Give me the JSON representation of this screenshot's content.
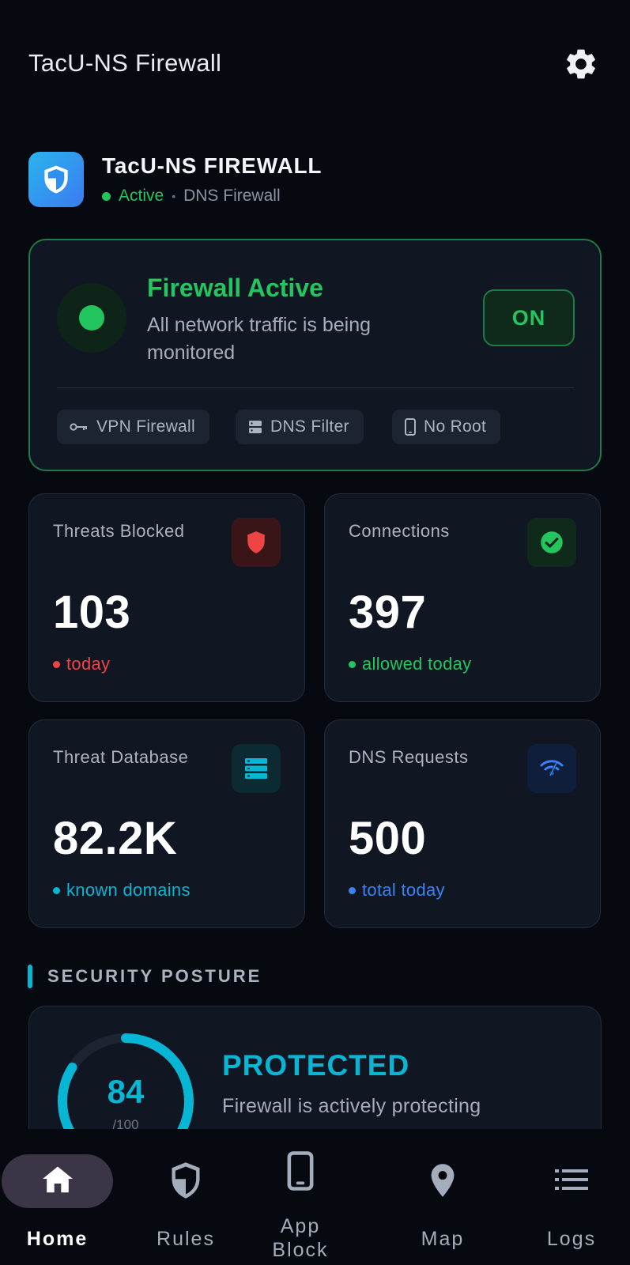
{
  "app_bar": {
    "title": "TacU-NS Firewall",
    "settings_icon": "gear-icon"
  },
  "brand": {
    "name": "TacU-NS FIREWALL",
    "status": "Active",
    "separator": "•",
    "mode": "DNS Firewall",
    "logo_icon": "shield-icon"
  },
  "firewall": {
    "title": "Firewall Active",
    "description": "All network traffic is being monitored",
    "toggle_label": "ON",
    "chips": [
      {
        "label": "VPN Firewall",
        "icon": "key-icon"
      },
      {
        "label": "DNS Filter",
        "icon": "server-icon"
      },
      {
        "label": "No Root",
        "icon": "phone-icon"
      }
    ]
  },
  "stats": {
    "threats": {
      "label": "Threats Blocked",
      "value": "103",
      "sub": "today",
      "icon": "shield-icon"
    },
    "connections": {
      "label": "Connections",
      "value": "397",
      "sub": "allowed today",
      "icon": "check-circle-icon"
    },
    "database": {
      "label": "Threat Database",
      "value": "82.2K",
      "sub": "known domains",
      "icon": "database-icon"
    },
    "dns": {
      "label": "DNS Requests",
      "value": "500",
      "sub": "total today",
      "icon": "wifi-icon"
    }
  },
  "posture": {
    "section_title": "SECURITY POSTURE",
    "score": "84",
    "score_max": "/100",
    "score_fraction": 0.84,
    "status": "PROTECTED",
    "description": "Firewall is actively protecting"
  },
  "nav": {
    "items": [
      {
        "label": "Home",
        "icon": "home-icon",
        "active": true
      },
      {
        "label": "Rules",
        "icon": "shield-icon"
      },
      {
        "label": "App Block",
        "icon": "phone-icon"
      },
      {
        "label": "Map",
        "icon": "map-pin-icon"
      },
      {
        "label": "Logs",
        "icon": "list-icon"
      }
    ]
  },
  "colors": {
    "background": "#06090f",
    "card": "#111722",
    "success": "#22c55e",
    "danger": "#ef4444",
    "info": "#06b6d4",
    "accent_blue": "#3b82f6"
  }
}
